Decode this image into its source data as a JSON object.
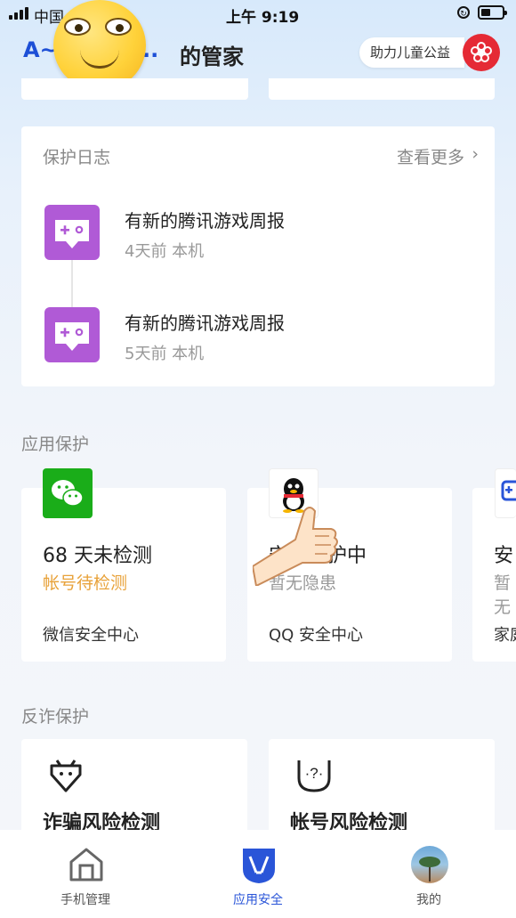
{
  "status_bar": {
    "carrier": "中国",
    "time": "上午 9:19"
  },
  "header": {
    "title_prefix": "A~",
    "title_dots": "..",
    "title_suffix": "的管家",
    "badge_label": "助力儿童公益"
  },
  "protection_log": {
    "title": "保护日志",
    "more_label": "查看更多",
    "items": [
      {
        "title": "有新的腾讯游戏周报",
        "meta": "4天前 本机"
      },
      {
        "title": "有新的腾讯游戏周报",
        "meta": "5天前 本机"
      }
    ]
  },
  "app_protection": {
    "title": "应用保护",
    "cards": [
      {
        "headline": "68 天未检测",
        "status": "帐号待检测",
        "name": "微信安全中心",
        "icon": "wechat-icon"
      },
      {
        "headline": "安全保护中",
        "status": "暂无隐患",
        "name": "QQ 安全中心",
        "icon": "qq-penguin-icon"
      },
      {
        "headline": "安",
        "status": "暂无",
        "name": "家庭",
        "icon": "family-icon"
      }
    ]
  },
  "fraud_protection": {
    "title": "反诈保护",
    "cards": [
      {
        "title": "诈骗风险检测",
        "icon": "robot-shield-icon"
      },
      {
        "title": "帐号风险检测",
        "icon": "question-shield-icon"
      }
    ]
  },
  "tabbar": {
    "tabs": [
      {
        "label": "手机管理",
        "icon": "house-icon"
      },
      {
        "label": "应用安全",
        "icon": "security-shield-icon"
      },
      {
        "label": "我的",
        "icon": "avatar"
      }
    ],
    "active_color": "#2a55d8"
  },
  "colors": {
    "accent": "#1d4fd6",
    "warning": "#e8a23a",
    "game_purple": "#b05ad6",
    "wechat_green": "#1aad19",
    "badge_red": "#e52a35"
  }
}
